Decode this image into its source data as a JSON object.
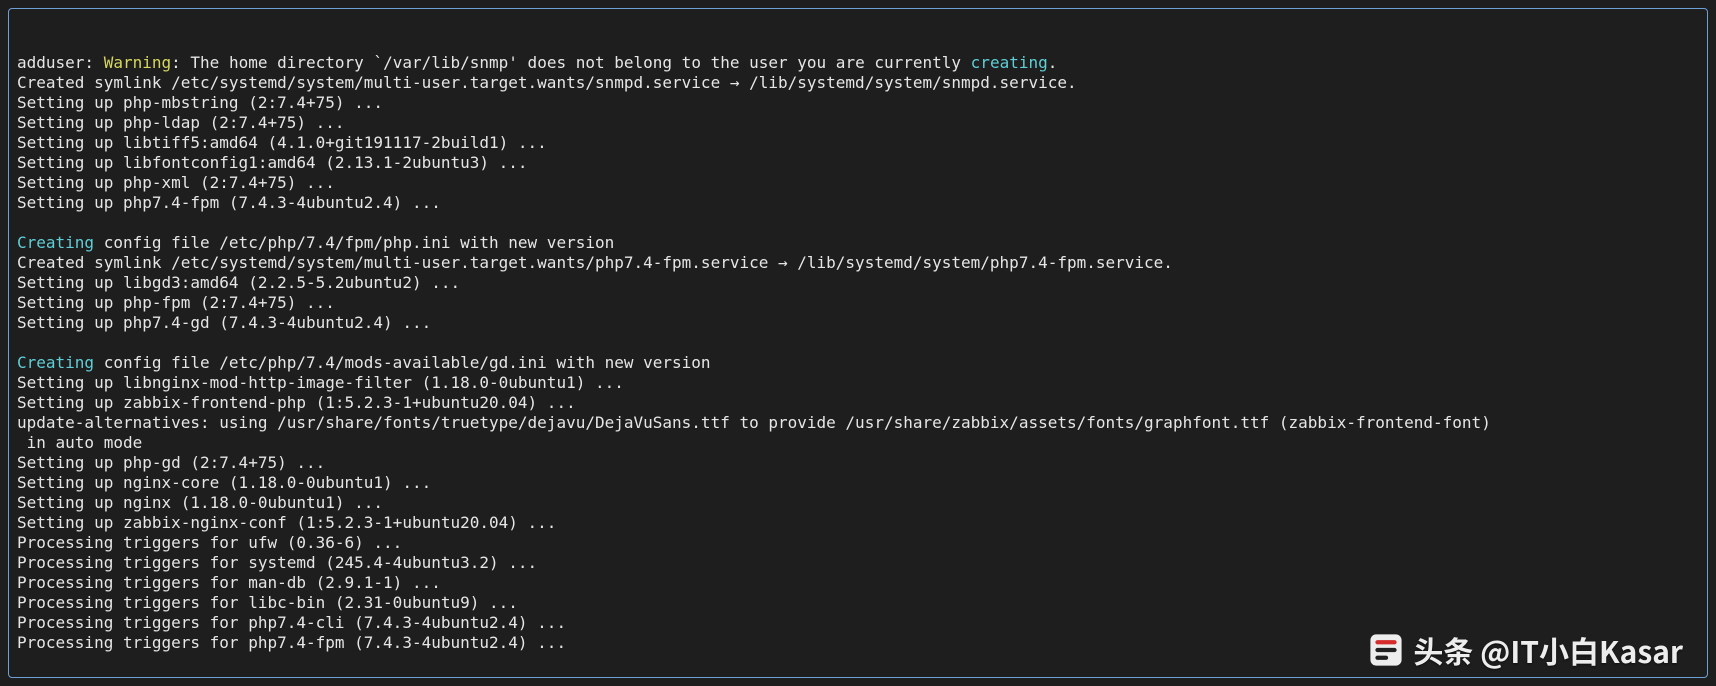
{
  "terminal": {
    "lines": [
      {
        "segments": [
          {
            "text": "adduser: ",
            "class": ""
          },
          {
            "text": "Warning",
            "class": "yellow"
          },
          {
            "text": ": The home directory `/var/lib/snmp' does not belong to the user you are currently ",
            "class": ""
          },
          {
            "text": "creating",
            "class": "cyan"
          },
          {
            "text": ".",
            "class": ""
          }
        ]
      },
      {
        "segments": [
          {
            "text": "Created symlink /etc/systemd/system/multi-user.target.wants/snmpd.service → /lib/systemd/system/snmpd.service.",
            "class": ""
          }
        ]
      },
      {
        "segments": [
          {
            "text": "Setting up php-mbstring (2:7.4+75) ...",
            "class": ""
          }
        ]
      },
      {
        "segments": [
          {
            "text": "Setting up php-ldap (2:7.4+75) ...",
            "class": ""
          }
        ]
      },
      {
        "segments": [
          {
            "text": "Setting up libtiff5:amd64 (4.1.0+git191117-2build1) ...",
            "class": ""
          }
        ]
      },
      {
        "segments": [
          {
            "text": "Setting up libfontconfig1:amd64 (2.13.1-2ubuntu3) ...",
            "class": ""
          }
        ]
      },
      {
        "segments": [
          {
            "text": "Setting up php-xml (2:7.4+75) ...",
            "class": ""
          }
        ]
      },
      {
        "segments": [
          {
            "text": "Setting up php7.4-fpm (7.4.3-4ubuntu2.4) ...",
            "class": ""
          }
        ]
      },
      {
        "segments": [
          {
            "text": "",
            "class": ""
          }
        ]
      },
      {
        "segments": [
          {
            "text": "Creating",
            "class": "cyan"
          },
          {
            "text": " config file /etc/php/7.4/fpm/php.ini with new version",
            "class": ""
          }
        ]
      },
      {
        "segments": [
          {
            "text": "Created symlink /etc/systemd/system/multi-user.target.wants/php7.4-fpm.service → /lib/systemd/system/php7.4-fpm.service.",
            "class": ""
          }
        ]
      },
      {
        "segments": [
          {
            "text": "Setting up libgd3:amd64 (2.2.5-5.2ubuntu2) ...",
            "class": ""
          }
        ]
      },
      {
        "segments": [
          {
            "text": "Setting up php-fpm (2:7.4+75) ...",
            "class": ""
          }
        ]
      },
      {
        "segments": [
          {
            "text": "Setting up php7.4-gd (7.4.3-4ubuntu2.4) ...",
            "class": ""
          }
        ]
      },
      {
        "segments": [
          {
            "text": "",
            "class": ""
          }
        ]
      },
      {
        "segments": [
          {
            "text": "Creating",
            "class": "cyan"
          },
          {
            "text": " config file /etc/php/7.4/mods-available/gd.ini with new version",
            "class": ""
          }
        ]
      },
      {
        "segments": [
          {
            "text": "Setting up libnginx-mod-http-image-filter (1.18.0-0ubuntu1) ...",
            "class": ""
          }
        ]
      },
      {
        "segments": [
          {
            "text": "Setting up zabbix-frontend-php (1:5.2.3-1+ubuntu20.04) ...",
            "class": ""
          }
        ]
      },
      {
        "segments": [
          {
            "text": "update-alternatives: using /usr/share/fonts/truetype/dejavu/DejaVuSans.ttf to provide /usr/share/zabbix/assets/fonts/graphfont.ttf (zabbix-frontend-font)",
            "class": ""
          }
        ]
      },
      {
        "segments": [
          {
            "text": " in auto mode",
            "class": ""
          }
        ]
      },
      {
        "segments": [
          {
            "text": "Setting up php-gd (2:7.4+75) ...",
            "class": ""
          }
        ]
      },
      {
        "segments": [
          {
            "text": "Setting up nginx-core (1.18.0-0ubuntu1) ...",
            "class": ""
          }
        ]
      },
      {
        "segments": [
          {
            "text": "Setting up nginx (1.18.0-0ubuntu1) ...",
            "class": ""
          }
        ]
      },
      {
        "segments": [
          {
            "text": "Setting up zabbix-nginx-conf (1:5.2.3-1+ubuntu20.04) ...",
            "class": ""
          }
        ]
      },
      {
        "segments": [
          {
            "text": "Processing triggers for ufw (0.36-6) ...",
            "class": ""
          }
        ]
      },
      {
        "segments": [
          {
            "text": "Processing triggers for systemd (245.4-4ubuntu3.2) ...",
            "class": ""
          }
        ]
      },
      {
        "segments": [
          {
            "text": "Processing triggers for man-db (2.9.1-1) ...",
            "class": ""
          }
        ]
      },
      {
        "segments": [
          {
            "text": "Processing triggers for libc-bin (2.31-0ubuntu9) ...",
            "class": ""
          }
        ]
      },
      {
        "segments": [
          {
            "text": "Processing triggers for php7.4-cli (7.4.3-4ubuntu2.4) ...",
            "class": ""
          }
        ]
      },
      {
        "segments": [
          {
            "text": "Processing triggers for php7.4-fpm (7.4.3-4ubuntu2.4) ...",
            "class": ""
          }
        ]
      }
    ]
  },
  "watermark": {
    "text": "头条 @IT小白Kasar"
  }
}
